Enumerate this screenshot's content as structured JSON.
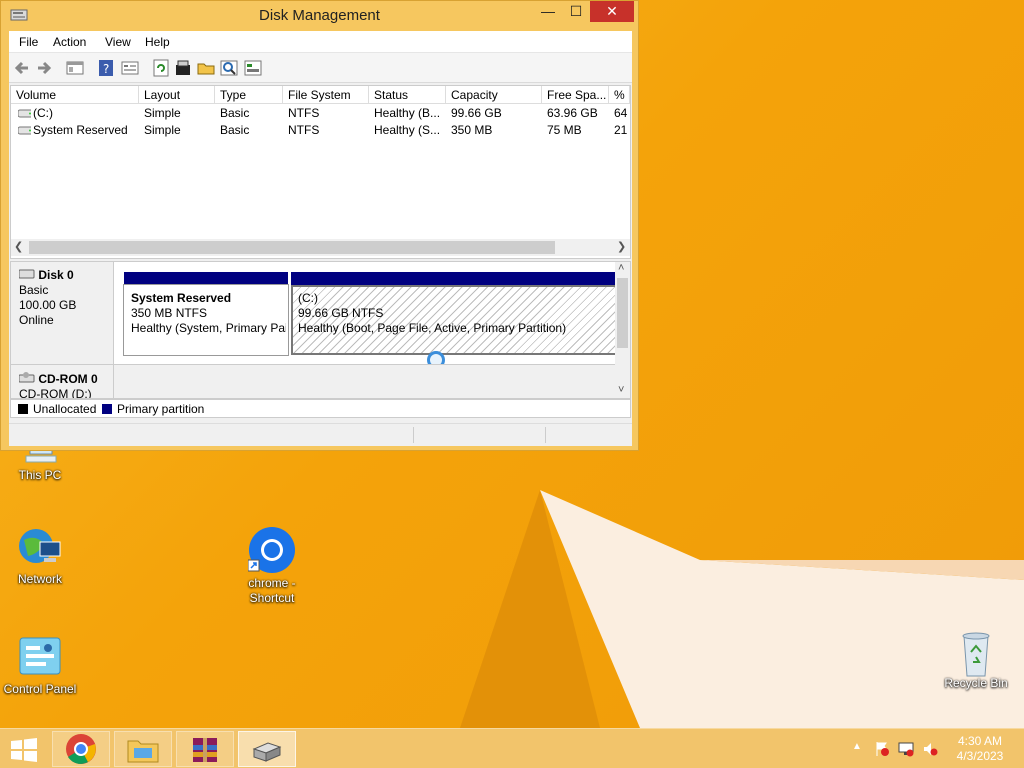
{
  "window": {
    "title": "Disk Management",
    "controls": {
      "minimize": "—",
      "maximize": "☐",
      "close": "✕"
    },
    "menu": [
      "File",
      "Action",
      "View",
      "Help"
    ],
    "volumes": {
      "columns": [
        "Volume",
        "Layout",
        "Type",
        "File System",
        "Status",
        "Capacity",
        "Free Spa...",
        "% F"
      ],
      "rows": [
        [
          "(C:)",
          "Simple",
          "Basic",
          "NTFS",
          "Healthy (B...",
          "99.66 GB",
          "63.96 GB",
          "64"
        ],
        [
          "System Reserved",
          "Simple",
          "Basic",
          "NTFS",
          "Healthy (S...",
          "350 MB",
          "75 MB",
          "21"
        ]
      ]
    },
    "disks": [
      {
        "name": "Disk 0",
        "type": "Basic",
        "size": "100.00 GB",
        "state": "Online",
        "partitions": [
          {
            "name": "System Reserved",
            "size": "350 MB NTFS",
            "status": "Healthy (System, Primary Pai"
          },
          {
            "name": "(C:)",
            "size": "99.66 GB NTFS",
            "status": "Healthy (Boot, Page File, Active, Primary Partition)"
          }
        ]
      },
      {
        "name": "CD-ROM 0",
        "type": "CD-ROM (D:)"
      }
    ],
    "legend": [
      {
        "label": "Unallocated",
        "color": "#000000"
      },
      {
        "label": "Primary partition",
        "color": "#000080"
      }
    ]
  },
  "desktop": {
    "icons": [
      "This PC",
      "Network",
      "chrome -\nShortcut",
      "Control Panel",
      "Recycle Bin"
    ]
  },
  "taskbar": {
    "items": [
      "start",
      "chrome",
      "file-explorer",
      "winrar",
      "disk-management"
    ],
    "time": "4:30 AM",
    "date": "4/3/2023"
  },
  "colors": {
    "accent": "#f4a30a",
    "primary_partition": "#000080",
    "close": "#c7312a"
  }
}
